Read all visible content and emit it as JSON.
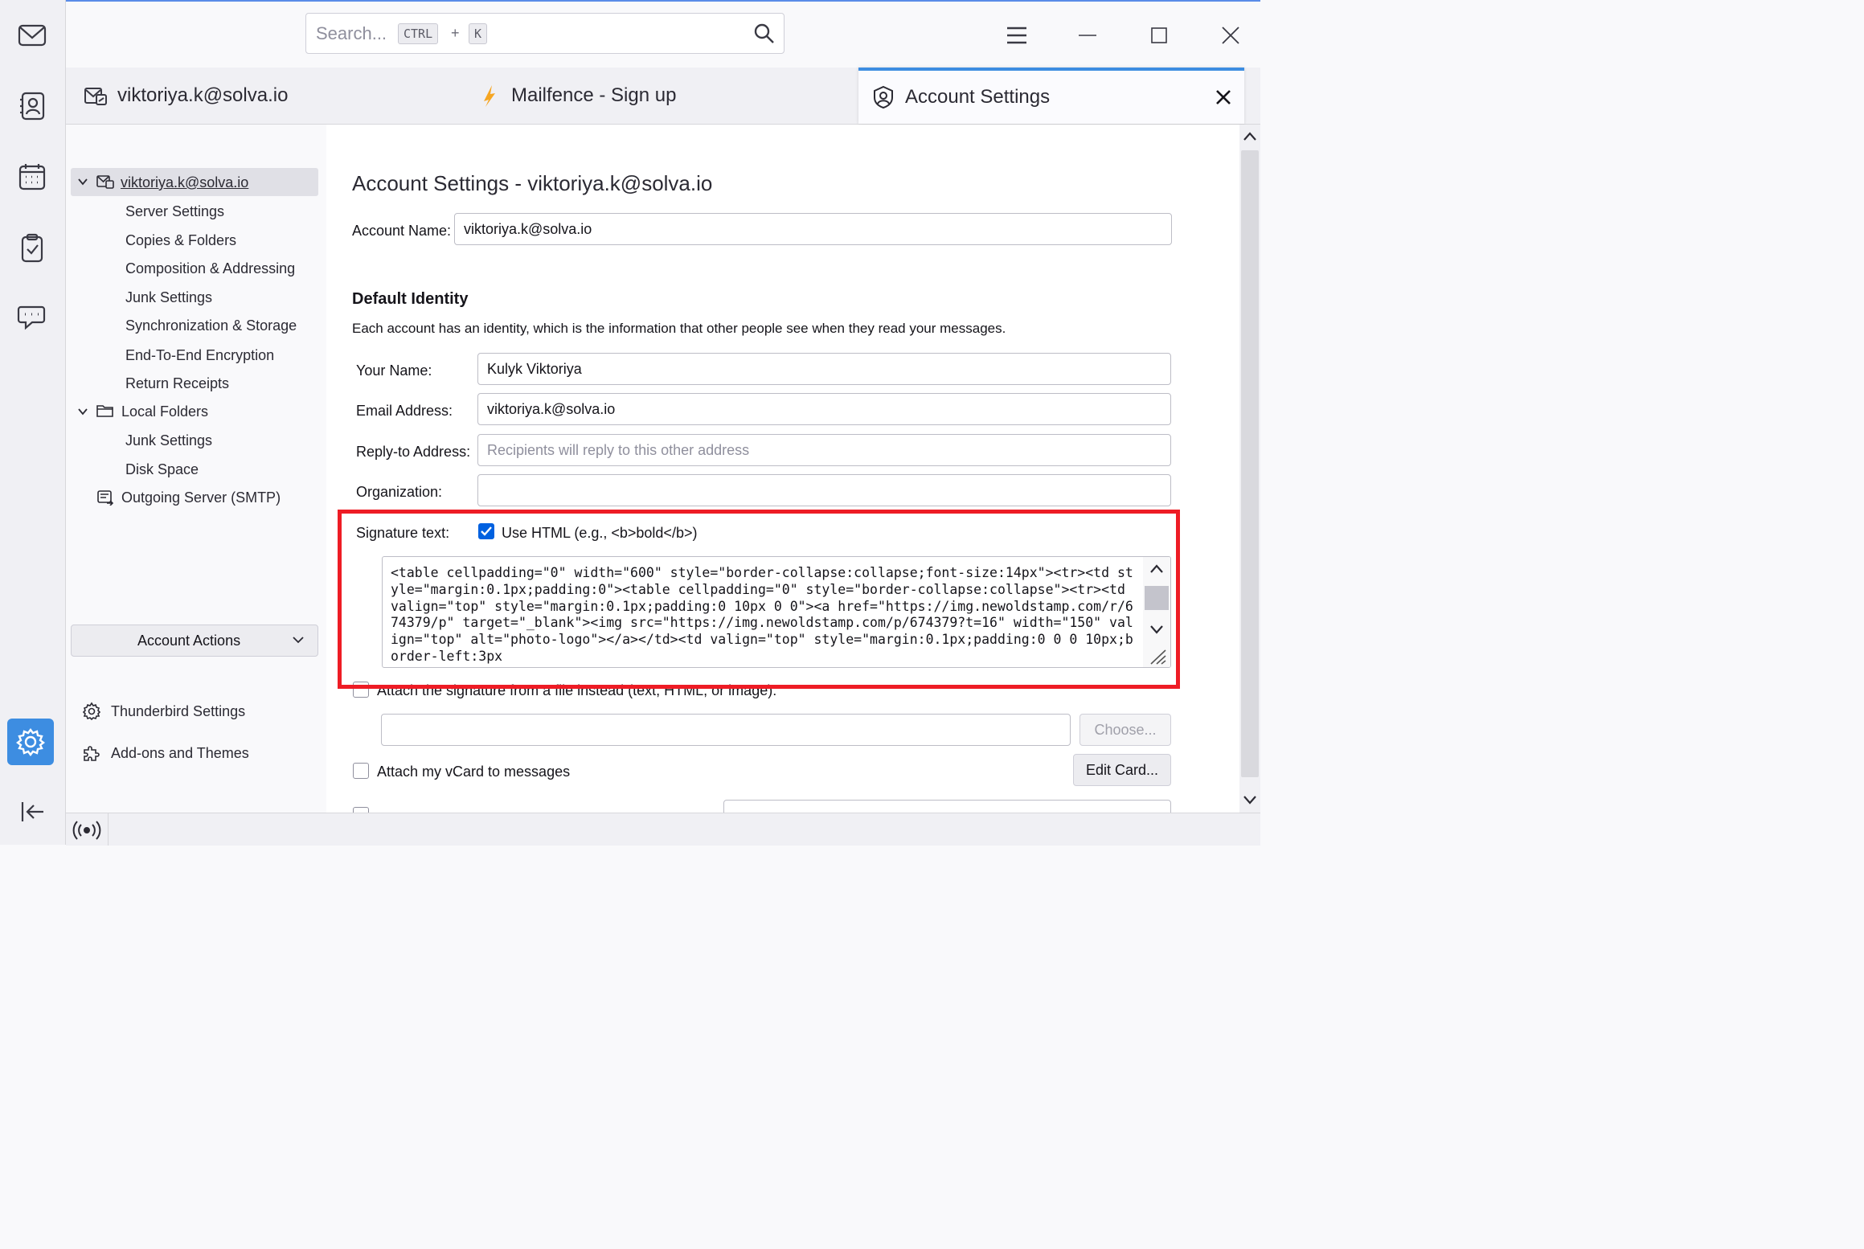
{
  "search": {
    "placeholder": "Search...",
    "key1": "CTRL",
    "plus": "+",
    "key2": "K"
  },
  "tabs": [
    {
      "label": "viktoriya.k@solva.io"
    },
    {
      "label": "Mailfence - Sign up"
    },
    {
      "label": "Account Settings"
    }
  ],
  "tree": {
    "account": "viktoriya.k@solva.io",
    "account_items": [
      "Server Settings",
      "Copies & Folders",
      "Composition & Addressing",
      "Junk Settings",
      "Synchronization & Storage",
      "End-To-End Encryption",
      "Return Receipts"
    ],
    "local_folders": "Local Folders",
    "local_items": [
      "Junk Settings",
      "Disk Space"
    ],
    "outgoing": "Outgoing Server (SMTP)",
    "account_actions": "Account Actions",
    "tb_settings": "Thunderbird Settings",
    "addons": "Add-ons and Themes"
  },
  "main": {
    "title": "Account Settings - viktoriya.k@solva.io",
    "account_name_label": "Account Name:",
    "account_name_value": "viktoriya.k@solva.io",
    "identity_heading": "Default Identity",
    "identity_desc": "Each account has an identity, which is the information that other people see when they read your messages.",
    "your_name_label": "Your Name:",
    "your_name_value": "Kulyk Viktoriya",
    "email_label": "Email Address:",
    "email_value": "viktoriya.k@solva.io",
    "reply_label": "Reply-to Address:",
    "reply_placeholder": "Recipients will reply to this other address",
    "org_label": "Organization:",
    "org_value": "",
    "signature_label": "Signature text:",
    "use_html_label": "Use HTML (e.g., <b>bold</b>)",
    "use_html_checked": true,
    "signature_value": "<table cellpadding=\"0\" width=\"600\" style=\"border-collapse:collapse;font-size:14px\"><tr><td style=\"margin:0.1px;padding:0\"><table cellpadding=\"0\" style=\"border-collapse:collapse\"><tr><td valign=\"top\" style=\"margin:0.1px;padding:0 10px 0 0\"><a href=\"https://img.newoldstamp.com/r/674379/p\" target=\"_blank\"><img src=\"https://img.newoldstamp.com/p/674379?t=16\" width=\"150\" valign=\"top\" alt=\"photo-logo\"></a></td><td valign=\"top\" style=\"margin:0.1px;padding:0 0 0 10px;border-left:3px",
    "attach_file_label": "Attach the signature from a file instead (text, HTML, or image):",
    "choose_button": "Choose...",
    "vcard_label": "Attach my vCard to messages",
    "edit_card_button": "Edit Card..."
  },
  "colors": {
    "accent": "#3d8de1",
    "highlight": "#ee1c25",
    "checkbox": "#0061e0"
  }
}
